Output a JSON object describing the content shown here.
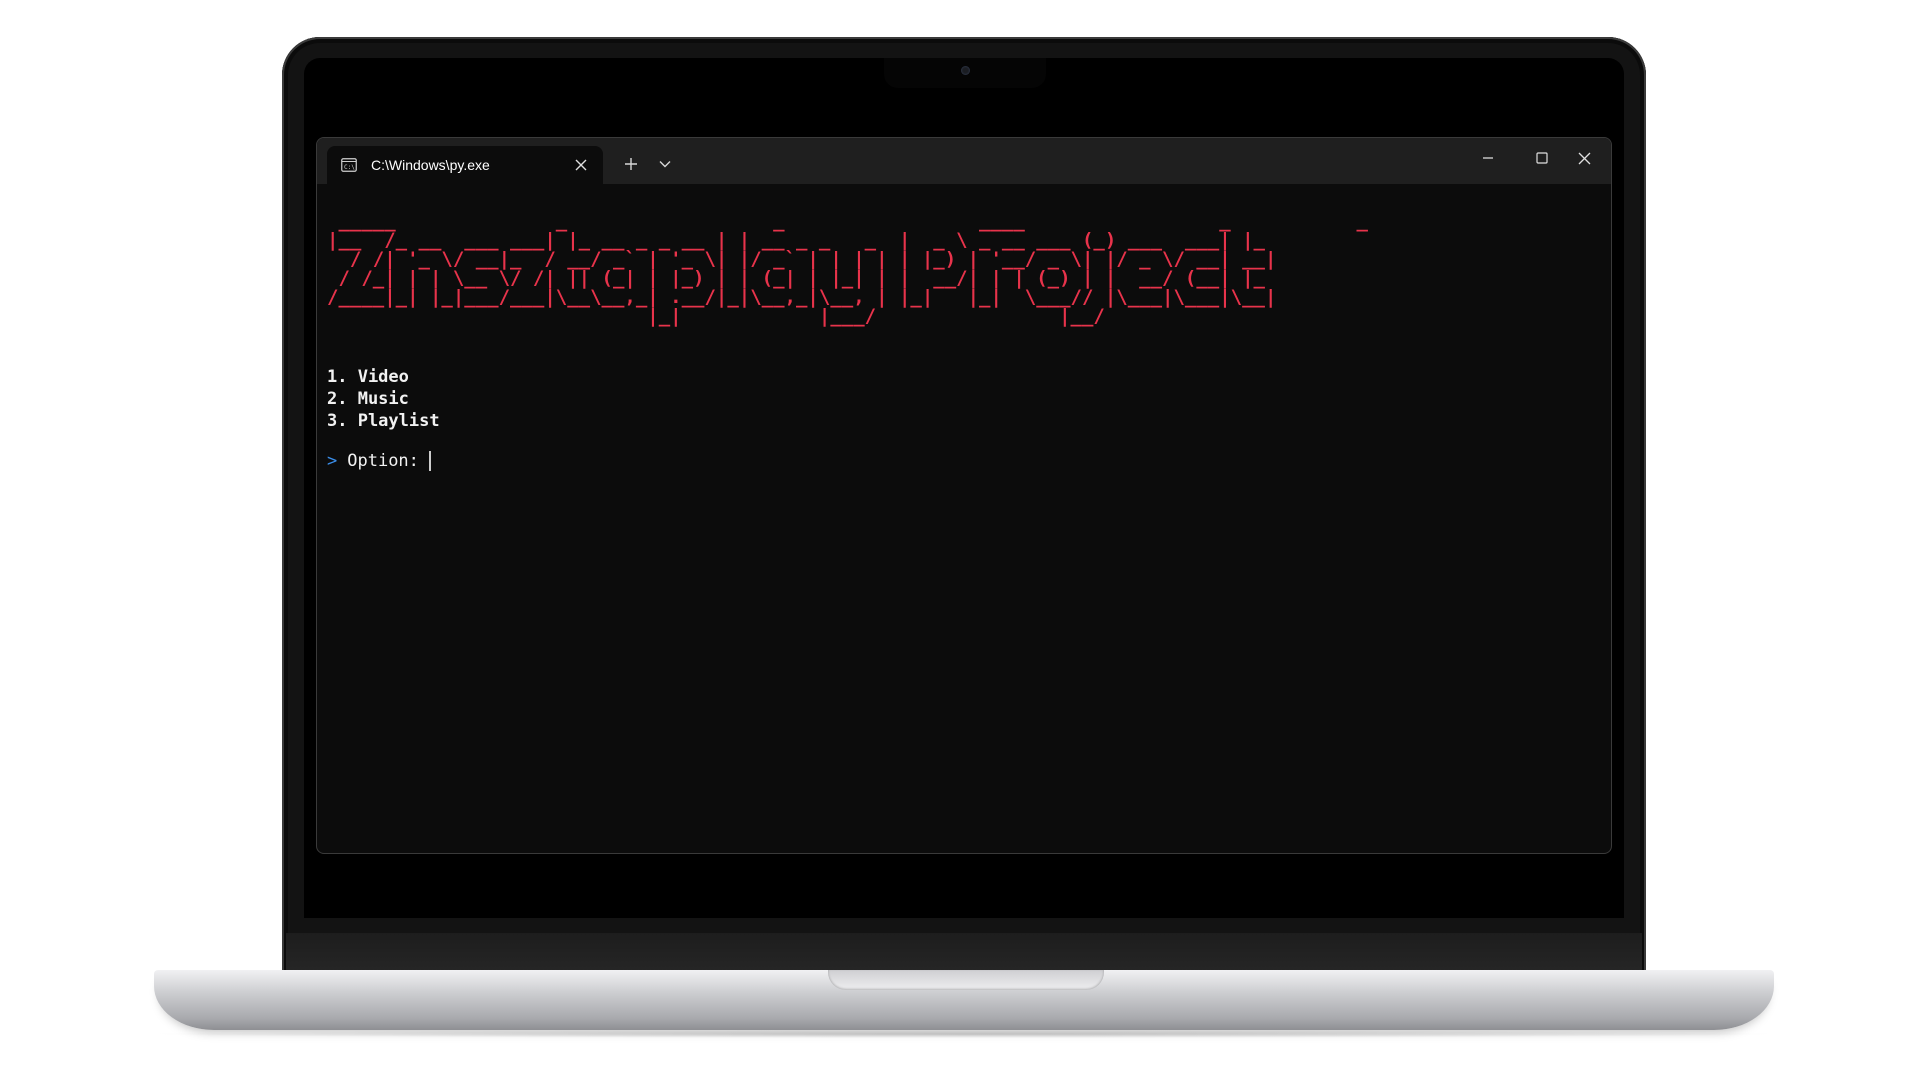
{
  "terminal": {
    "tab_title": "C:\\Windows\\py.exe",
    "ascii_banner": " _____              _                  _                 ____                 _           _   \n|__  /_ __  ___ ___| |_ __ _ _ __ | | __ _ _   _  |  _ \\ _ __ ___ (_) ___  ___| |_ \n  / /| '_ \\/ __|_  / __/ _` | '_ \\| |/ _` | | | | | |_) | '__/ _ \\| |/ _ \\/ __| __|\n / /_| | | \\__ \\/ /| || (_| | |_) | | (_| | |_| | |  __/| | | (_) | |  __/ (__| |_ \n/____|_| |_|___/___|\\__\\__,_| .__/|_|\\__,_|\\__, | |_|   |_|  \\___// |\\___|\\___|\\__|\n                            |_|            |___/                |__/                ",
    "menu_items": [
      "1. Video",
      "2. Music",
      "3. Playlist"
    ],
    "prompt_symbol": ">",
    "prompt_label": "Option:"
  },
  "colors": {
    "banner": "#e8334b",
    "prompt_symbol": "#3b8eea",
    "terminal_bg": "#0c0c0c",
    "titlebar_bg": "#1f1f1f"
  },
  "icons": {
    "tab_icon": "terminal-icon",
    "tab_close": "close-icon",
    "new_tab": "plus-icon",
    "dropdown": "chevron-down-icon",
    "minimize": "minimize-icon",
    "maximize": "maximize-icon",
    "close_window": "close-icon"
  }
}
